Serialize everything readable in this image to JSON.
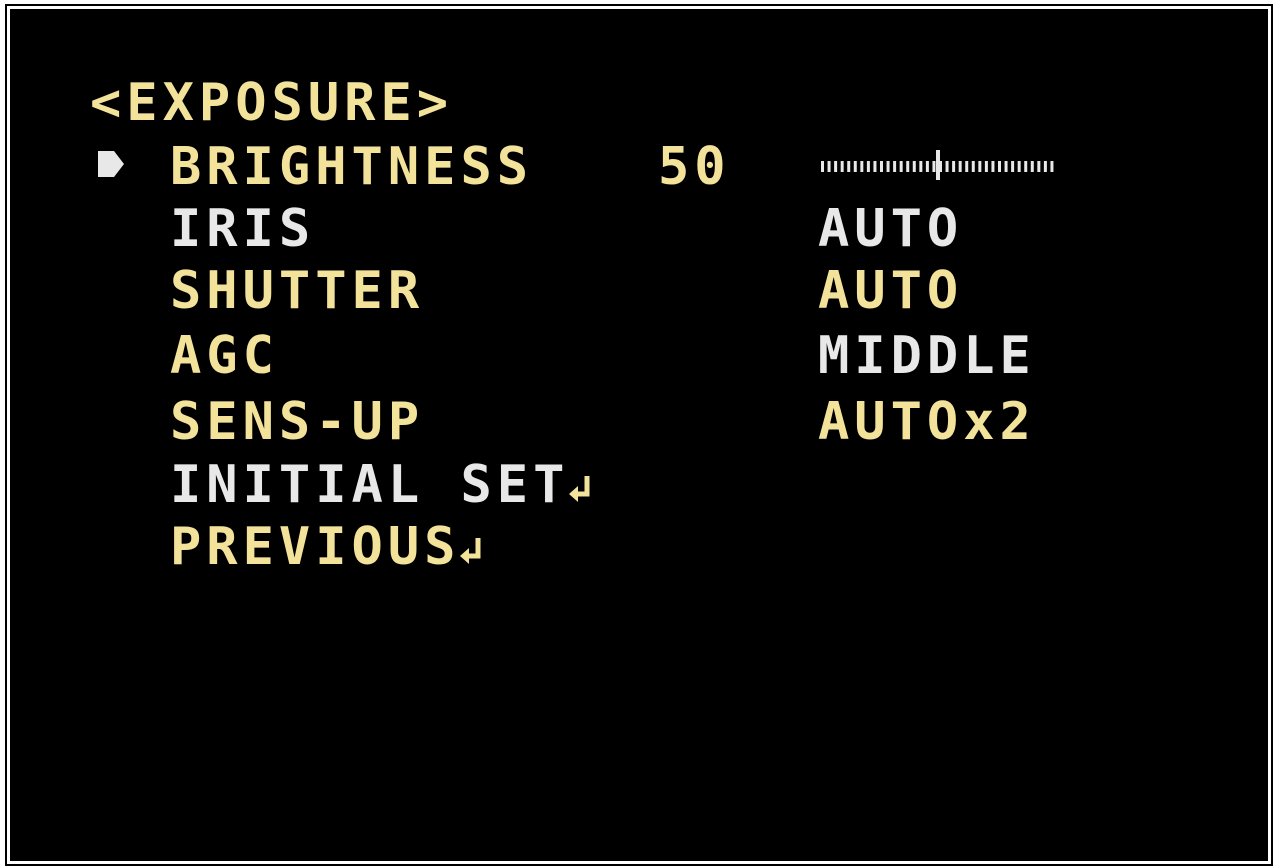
{
  "menu": {
    "title": "<EXPOSURE>",
    "items": [
      {
        "label": "BRIGHTNESS",
        "value": "50",
        "selected": true,
        "slider_level": 0.5
      },
      {
        "label": "IRIS",
        "value": "AUTO"
      },
      {
        "label": "SHUTTER",
        "value": "AUTO"
      },
      {
        "label": "AGC",
        "value": "MIDDLE"
      },
      {
        "label": "SENS-UP",
        "value": "AUTOx2"
      },
      {
        "label": "INITIAL SET",
        "icon": "enter-icon"
      },
      {
        "label": "PREVIOUS",
        "icon": "enter-icon"
      }
    ]
  },
  "colors": {
    "background": "#000000",
    "text_yellow": "#f2e29a",
    "text_blue": "#b9c4f2",
    "text_white": "#e8e8e8"
  },
  "icons": {
    "cursor": "triangle-cursor-icon",
    "enter": "enter-icon"
  }
}
